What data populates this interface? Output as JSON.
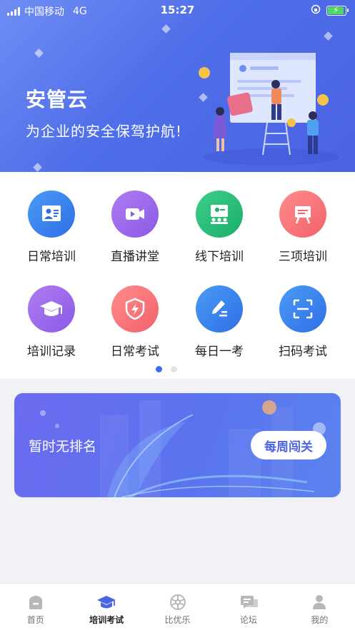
{
  "status_bar": {
    "carrier": "中国移动",
    "network": "4G",
    "time": "15:27"
  },
  "hero": {
    "title": "安管云",
    "subtitle": "为企业的安全保驾护航!"
  },
  "grid": [
    {
      "label": "日常培训",
      "icon": "training-board-icon",
      "color_from": "#4a9cf5",
      "color_to": "#2f6ee6"
    },
    {
      "label": "直播讲堂",
      "icon": "live-camera-icon",
      "color_from": "#b07cf0",
      "color_to": "#8a5ae8"
    },
    {
      "label": "线下培训",
      "icon": "offline-class-icon",
      "color_from": "#3ccf8a",
      "color_to": "#1bae6b"
    },
    {
      "label": "三项培训",
      "icon": "easel-board-icon",
      "color_from": "#ff8c8c",
      "color_to": "#f2626a"
    },
    {
      "label": "培训记录",
      "icon": "graduation-cap-icon",
      "color_from": "#b07cf0",
      "color_to": "#8a5ae8"
    },
    {
      "label": "日常考试",
      "icon": "shield-bolt-icon",
      "color_from": "#ff8c8c",
      "color_to": "#f2626a"
    },
    {
      "label": "每日一考",
      "icon": "pen-write-icon",
      "color_from": "#4a9cf5",
      "color_to": "#2f6ee6"
    },
    {
      "label": "扫码考试",
      "icon": "scan-code-icon",
      "color_from": "#4a9cf5",
      "color_to": "#2f6ee6"
    }
  ],
  "pager": {
    "pages": 2,
    "current": 1
  },
  "ranking": {
    "text": "暂时无排名",
    "button": "每周闯关"
  },
  "tabbar": [
    {
      "label": "首页",
      "icon": "home-icon",
      "active": false
    },
    {
      "label": "培训考试",
      "icon": "graduation-cap-icon",
      "active": true
    },
    {
      "label": "比优乐",
      "icon": "wheel-icon",
      "active": false
    },
    {
      "label": "论坛",
      "icon": "chat-icon",
      "active": false
    },
    {
      "label": "我的",
      "icon": "user-icon",
      "active": false
    }
  ],
  "colors": {
    "accent": "#4a64e6",
    "hero": "#5570ea",
    "active_tab": "#4a64e6",
    "inactive_tab": "#b8b8b8"
  }
}
